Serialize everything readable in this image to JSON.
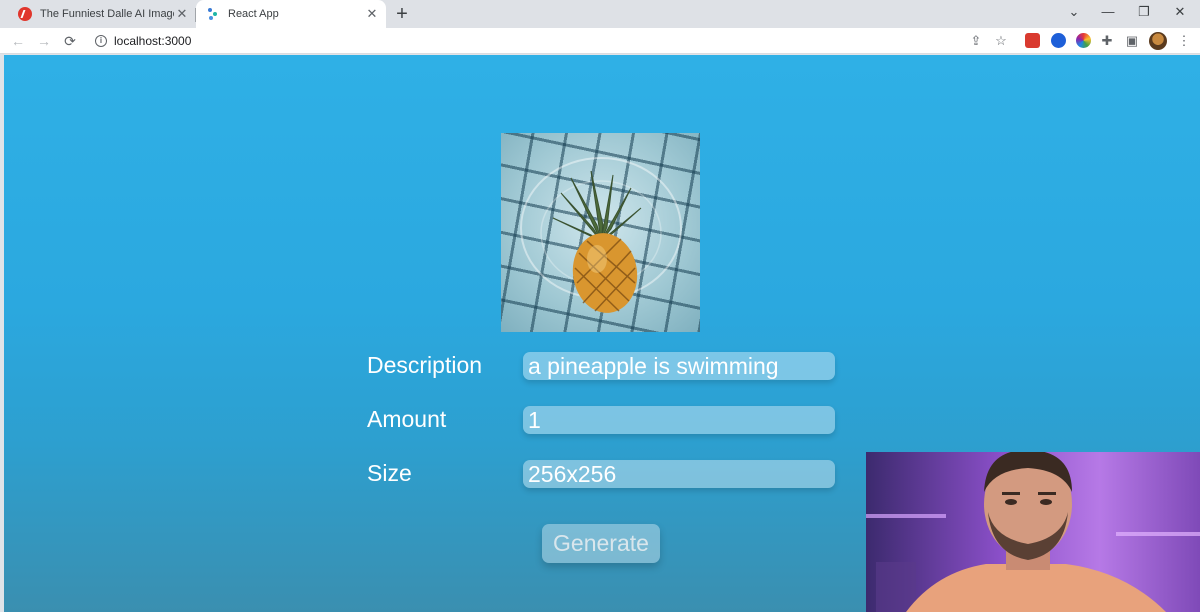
{
  "browser": {
    "tabs": [
      {
        "title": "The Funniest Dalle AI Images Fro"
      },
      {
        "title": "React App"
      }
    ],
    "url": "localhost:3000"
  },
  "icons": {
    "tab1_favicon": "red-favicon-icon",
    "tab2_favicon": "react-app-favicon-icon",
    "back": "arrow-left-icon",
    "forward": "arrow-right-icon",
    "reload": "reload-icon",
    "site_info": "info-icon",
    "share": "share-icon",
    "bookmark": "star-icon",
    "extensions": "puzzle-icon",
    "side_panel": "side-panel-icon",
    "menu": "kebab-menu-icon"
  },
  "form": {
    "description_label": "Description",
    "description_value": "a pineapple is swimming",
    "amount_label": "Amount",
    "amount_value": "1",
    "size_label": "Size",
    "size_value": "256x256",
    "generate_label": "Generate"
  },
  "colors": {
    "page_background": "#2fb0e6",
    "text": "#ffffff",
    "tab_active": "#ffffff",
    "tabstrip": "#dee1e6"
  }
}
